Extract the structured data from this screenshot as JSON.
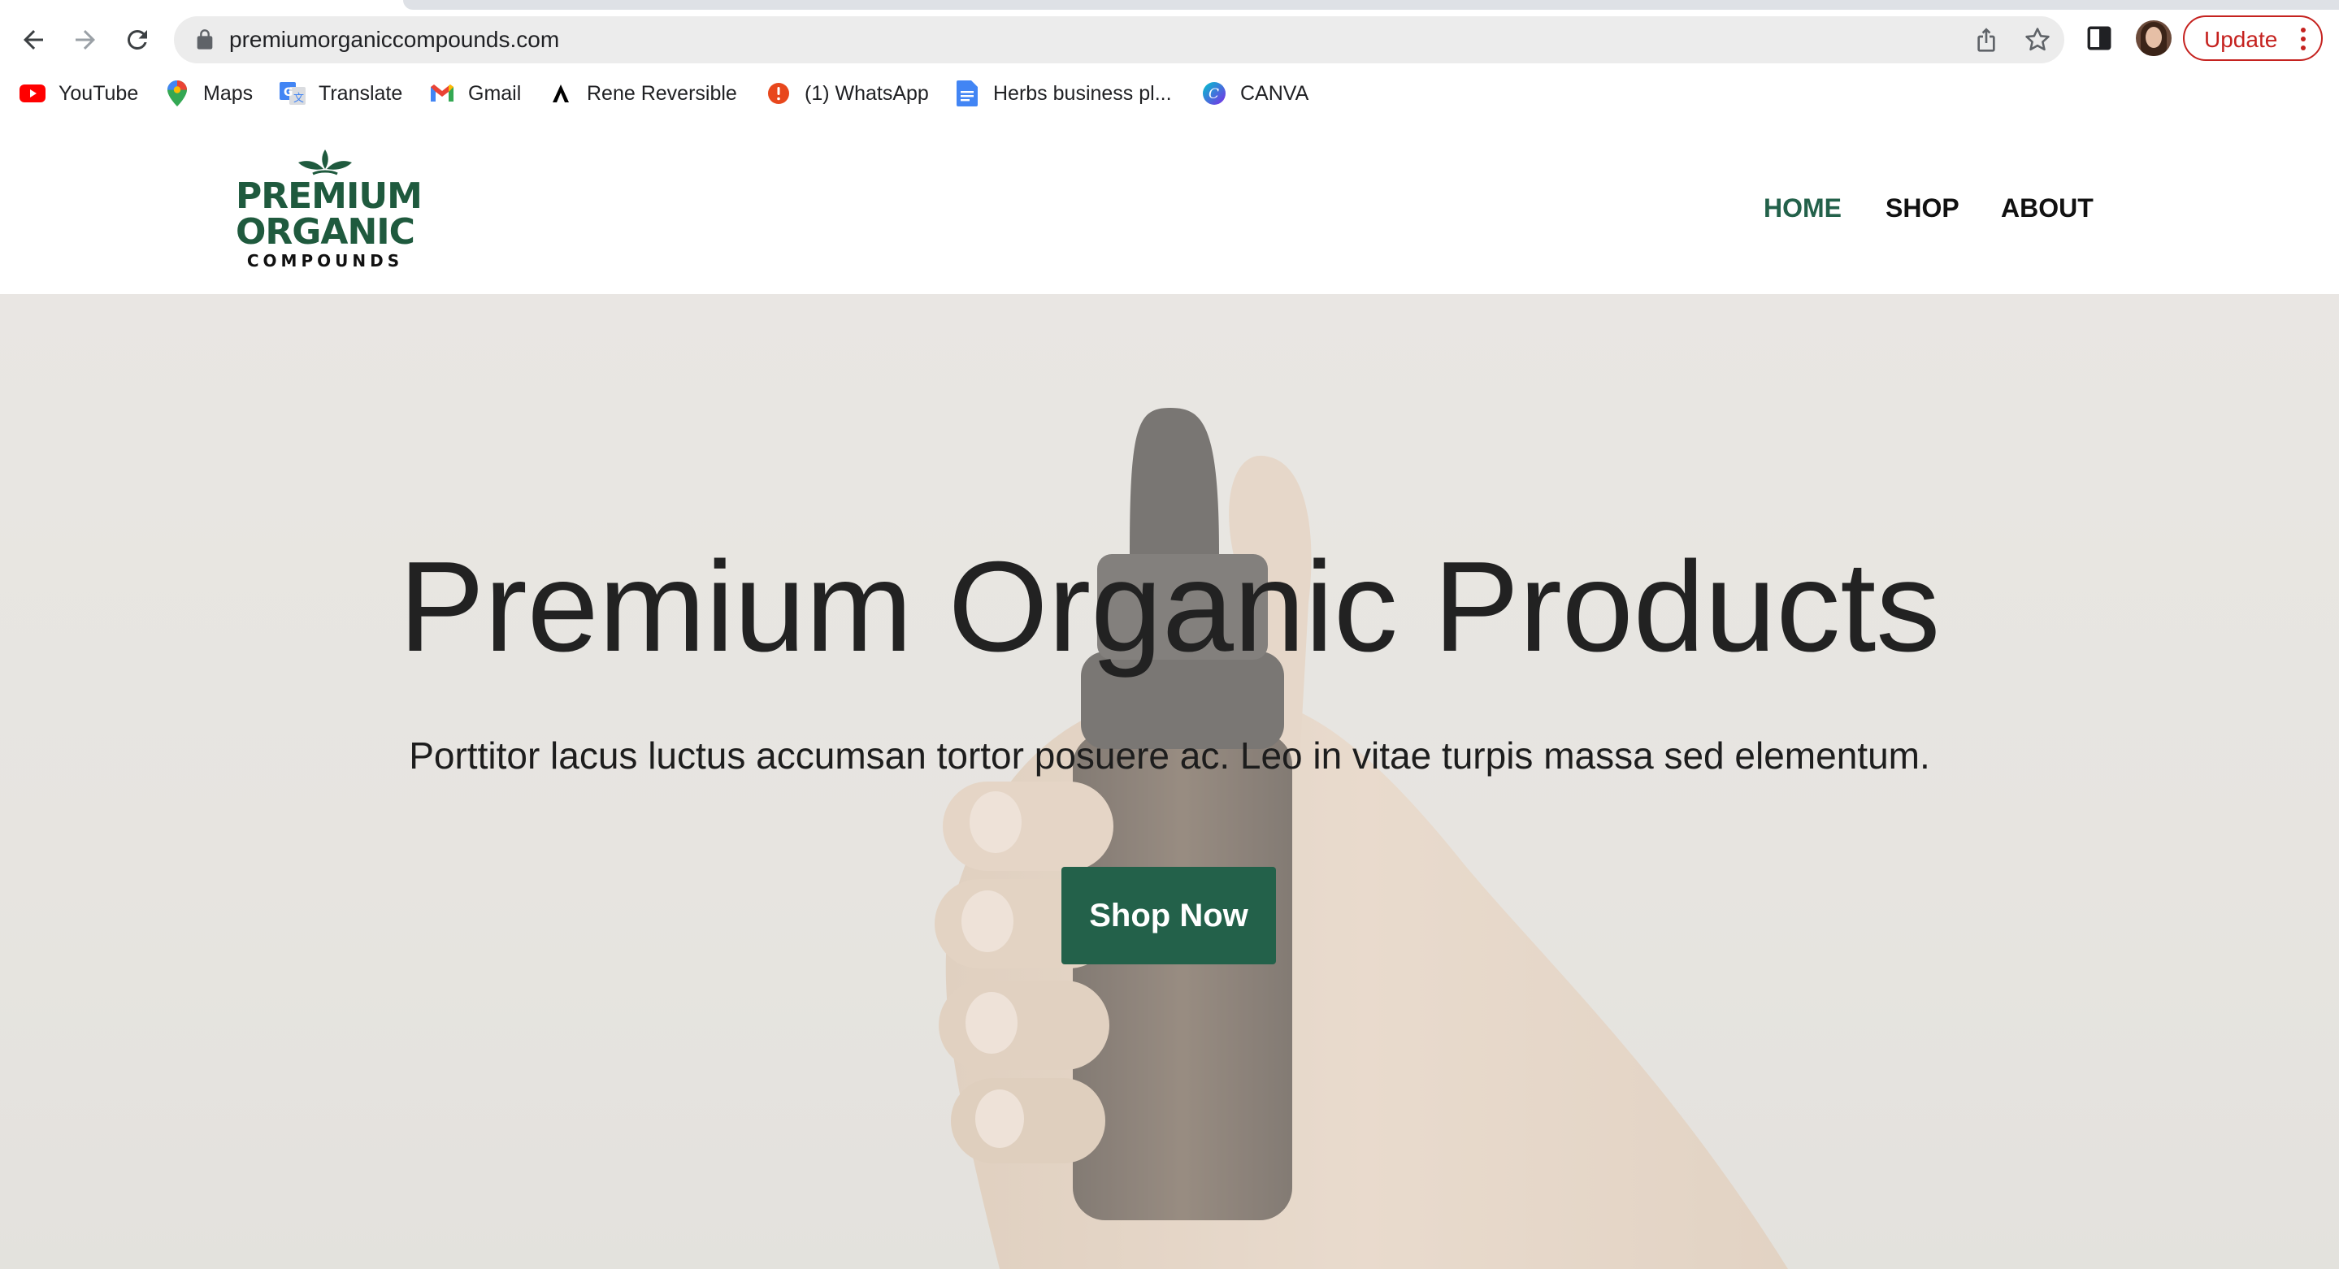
{
  "browser": {
    "url": "premiumorganiccompounds.com",
    "update_label": "Update",
    "icons": {
      "back": "arrow-left-icon",
      "forward": "arrow-right-icon",
      "reload": "reload-icon",
      "lock": "lock-icon",
      "share": "share-icon",
      "star": "star-icon",
      "side_panel": "side-panel-icon",
      "menu": "kebab-menu-icon"
    },
    "bookmarks": [
      {
        "label": "YouTube",
        "icon": "youtube-icon",
        "color": "#ff0000"
      },
      {
        "label": "Maps",
        "icon": "maps-icon",
        "color": "#34a853"
      },
      {
        "label": "Translate",
        "icon": "translate-icon",
        "color": "#4285f4"
      },
      {
        "label": "Gmail",
        "icon": "gmail-icon",
        "color": "#ea4335"
      },
      {
        "label": "Rene Reversible",
        "icon": "rene-reversible-icon",
        "color": "#000000"
      },
      {
        "label": "(1) WhatsApp",
        "icon": "whatsapp-alert-icon",
        "color": "#e8471c"
      },
      {
        "label": "Herbs business pl...",
        "icon": "google-docs-icon",
        "color": "#4285f4"
      },
      {
        "label": "CANVA",
        "icon": "canva-icon",
        "color": "#7d2ae8"
      }
    ]
  },
  "site": {
    "logo": {
      "line1": "PREMIUM",
      "line2": "ORGANIC",
      "line3": "COMPOUNDS",
      "brand_color": "#1f5a3e"
    },
    "nav": [
      {
        "label": "HOME",
        "active": true
      },
      {
        "label": "SHOP",
        "active": false
      },
      {
        "label": "ABOUT",
        "active": false
      }
    ],
    "hero": {
      "title": "Premium Organic Products",
      "subtitle": "Porttitor lacus luctus accumsan tortor posuere ac. Leo in vitae turpis massa sed elementum.",
      "cta_label": "Shop Now",
      "cta_color": "#23614a"
    }
  }
}
